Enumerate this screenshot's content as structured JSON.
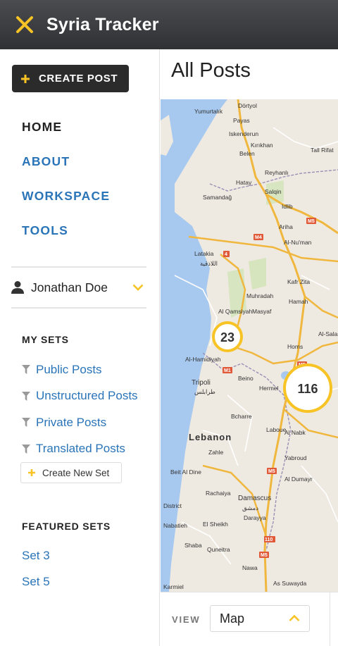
{
  "header": {
    "title": "Syria Tracker",
    "close_icon": "close-icon"
  },
  "colors": {
    "accent": "#f7c325",
    "link": "#2a74b8",
    "header_bg": "#3a3c3f",
    "water": "#a7c9f0"
  },
  "sidebar": {
    "create_post_label": "CREATE POST",
    "nav": [
      {
        "label": "HOME",
        "active": true
      },
      {
        "label": "ABOUT"
      },
      {
        "label": "WORKSPACE"
      },
      {
        "label": "TOOLS"
      }
    ],
    "user": {
      "name": "Jonathan Doe"
    },
    "my_sets": {
      "title": "MY SETS",
      "items": [
        "Public Posts",
        "Unstructured Posts",
        "Private Posts",
        "Translated Posts"
      ],
      "create_label": "Create New Set"
    },
    "featured_sets": {
      "title": "FEATURED SETS",
      "items": [
        "Set 3",
        "Set 5"
      ]
    }
  },
  "main": {
    "title": "All Posts",
    "map": {
      "clusters": [
        {
          "count": "23"
        },
        {
          "count": "116"
        }
      ],
      "labels": {
        "yumurtalik": "Yumurtalık",
        "dortyol": "Dörtyol",
        "payas": "Payas",
        "iskenderun": "Iskenderun",
        "kirikhan": "Kırıkhan",
        "belen": "Belen",
        "tal_rifat": "Tall Rifat",
        "hatay": "Hatay",
        "reyhanli": "Reyhanlı",
        "samandag": "Samandağ",
        "salqin": "Salqin",
        "idlib": "Idlib",
        "ariha": "Ariha",
        "al_numan": "Al-Nu'man",
        "latakia": "Latakia",
        "latakia_ar": "اللاذقية",
        "kafr_zita": "Kafr Zita",
        "muhradah": "Muhradah",
        "hamah": "Hamah",
        "al_qamsiyah": "Al Qamsiyah",
        "masyaf": "Masyaf",
        "al_salam": "Al-Salam",
        "homs": "Homs",
        "al_hamidiyah": "Al-Hamidiyah",
        "tripoli": "Tripoli",
        "tripoli_ar": "طرابلس",
        "beino": "Beino",
        "hermel": "Hermel",
        "bcharre": "Bcharre",
        "laboue": "Laboue",
        "al_nabk": "Al Nabk",
        "lebanon": "Lebanon",
        "zahle": "Zahle",
        "yabroud": "Yabroud",
        "beit_al_dine": "Beit Al Dine",
        "al_dumayr": "Al Dumayr",
        "damascus": "Damascus",
        "damascus_ar": "دمشق",
        "rachaiya": "Rachaiya",
        "district": "District",
        "nabatieh": "Nabatieh",
        "el_sheikh": "El Sheikh",
        "daraya": "Darayya",
        "shaba": "Shaba",
        "quneitra": "Quneitra",
        "nawa": "Nawa",
        "karmiel": "Karmiel",
        "as_suwayda": "As Suwayda"
      },
      "road_shields": [
        "M5",
        "M4",
        "4",
        "M5",
        "M1",
        "M5",
        "110",
        "M5"
      ]
    },
    "view": {
      "label": "VIEW",
      "selected": "Map"
    }
  }
}
